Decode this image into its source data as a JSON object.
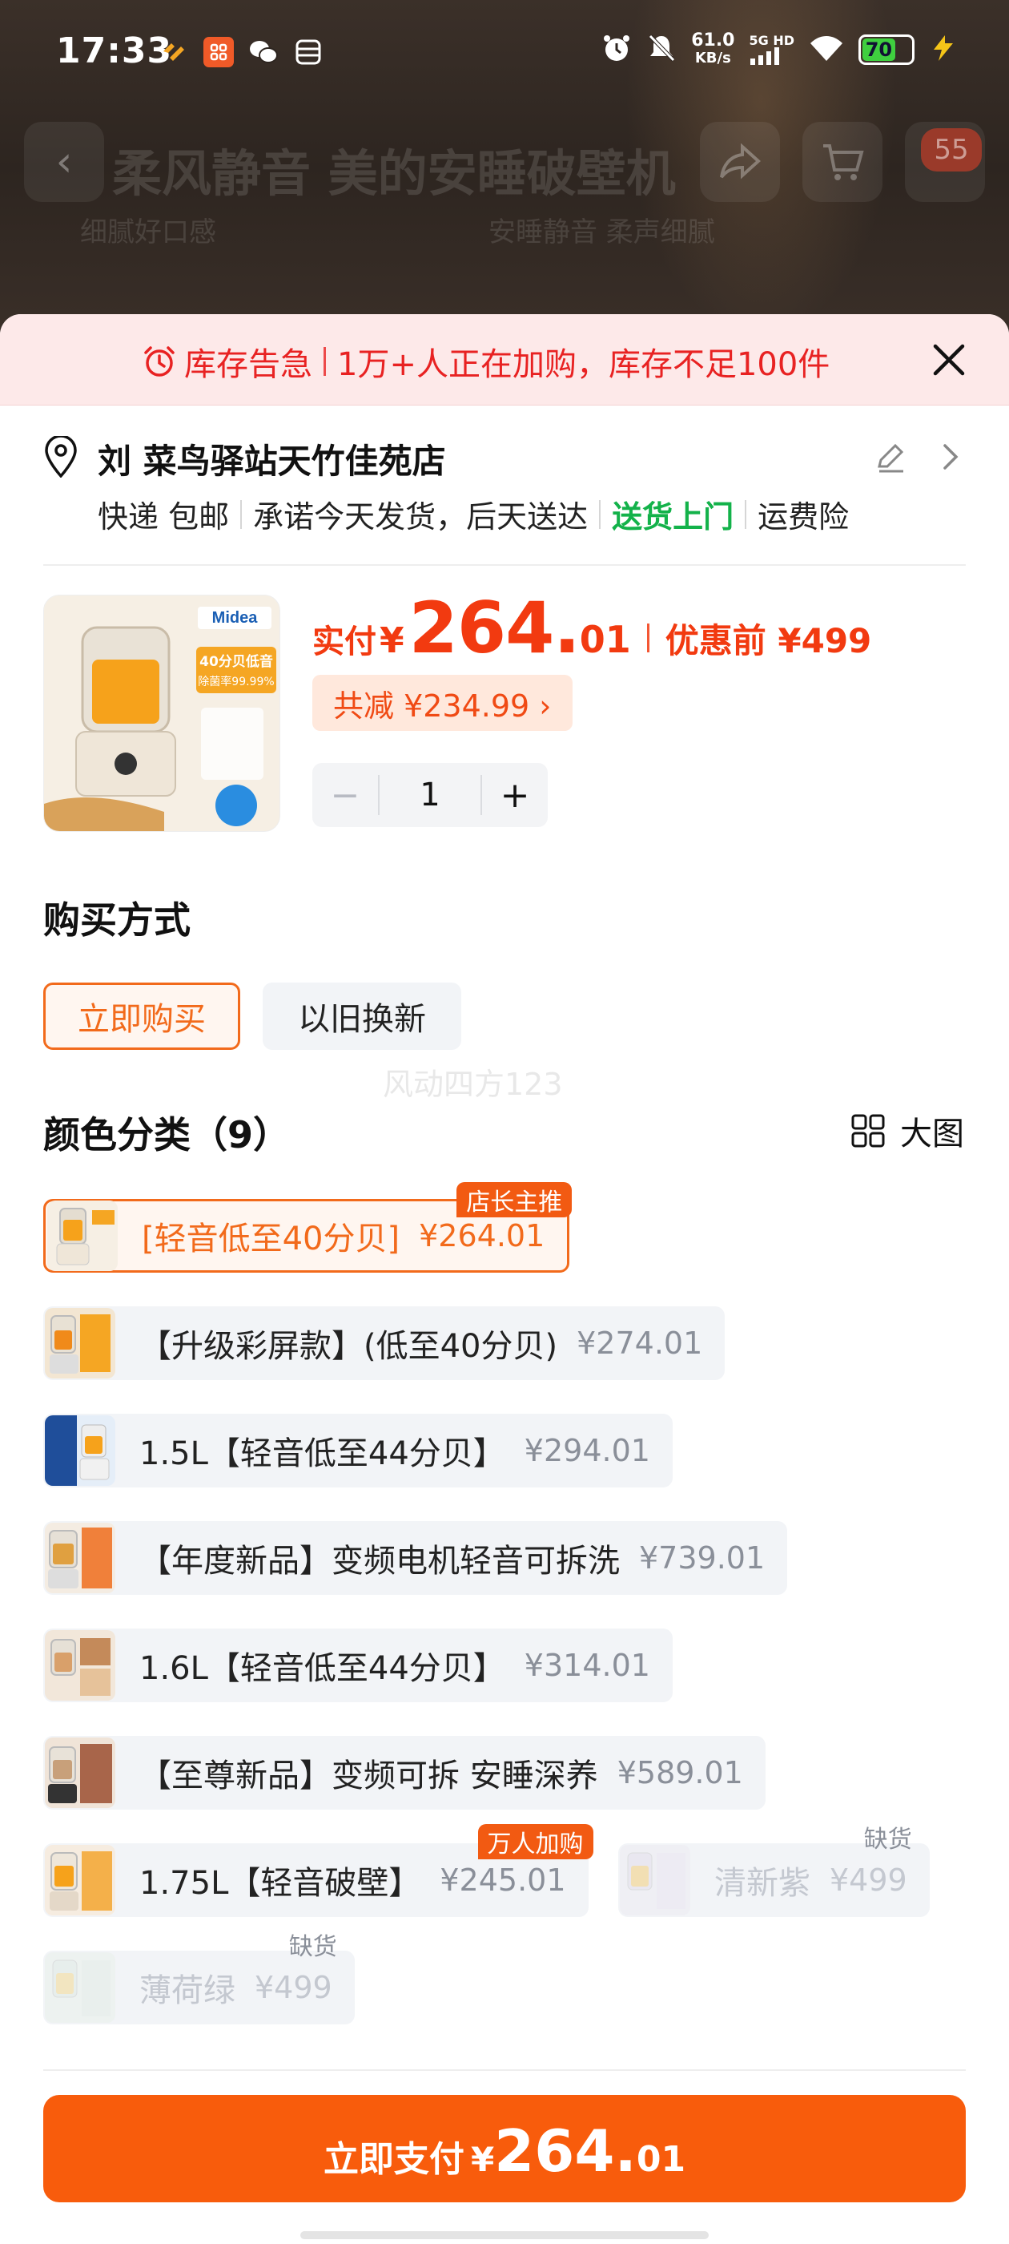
{
  "status_bar": {
    "time": "17:33",
    "net_speed": "61.0",
    "net_unit": "KB/s",
    "signal_label": "5G HD",
    "battery": "70",
    "battery_level": 0.7
  },
  "background_page": {
    "title": "柔风静音 美的安睡破壁机",
    "sub_left": "细腻好口感",
    "sub_right": "安睡静音 柔声细腻",
    "cart_badge": "55"
  },
  "alert": {
    "title": "库存告急",
    "message": "1万+人正在加购，库存不足100件",
    "color": "#e82222"
  },
  "address": {
    "name": "刘 菜鸟驿站天竹佳苑店",
    "delivery": [
      "快递 包邮",
      "承诺今天发货，后天送达",
      "送货上门",
      "运费险"
    ]
  },
  "product": {
    "price_label": "实付",
    "currency": "¥",
    "price_int": "264.",
    "price_dec": "01",
    "orig_label": "优惠前 ¥499",
    "discount": "共减 ¥234.99 ›",
    "quantity": "1",
    "img_brand": "Midea",
    "img_badge_1": "40分贝低音",
    "img_badge_2": "除菌率99.99%"
  },
  "purchase": {
    "title": "购买方式",
    "options": [
      "立即购买",
      "以旧换新"
    ]
  },
  "watermark": "风动四方123",
  "colors": {
    "title": "颜色分类（9）",
    "big_view": "大图",
    "items": [
      {
        "name": "[轻音低至40分贝]",
        "price": "¥264.01",
        "tag": "店长主推"
      },
      {
        "name": "【升级彩屏款】(低至40分贝)",
        "price": "¥274.01"
      },
      {
        "name": "1.5L【轻音低至44分贝】",
        "price": "¥294.01"
      },
      {
        "name": "【年度新品】变频电机轻音可拆洗",
        "price": "¥739.01"
      },
      {
        "name": "1.6L【轻音低至44分贝】",
        "price": "¥314.01"
      },
      {
        "name": "【至尊新品】变频可拆 安睡深养",
        "price": "¥589.01"
      },
      {
        "name": "1.75L【轻音破壁】",
        "price": "¥245.01",
        "tag": "万人加购"
      },
      {
        "name": "清新紫",
        "price": "¥499",
        "tag": "缺货"
      },
      {
        "name": "薄荷绿",
        "price": "¥499",
        "tag": "缺货"
      }
    ]
  },
  "pay": {
    "label": "立即支付",
    "currency": "¥",
    "int": "264.",
    "dec": "01",
    "color": "#f85c0c"
  }
}
